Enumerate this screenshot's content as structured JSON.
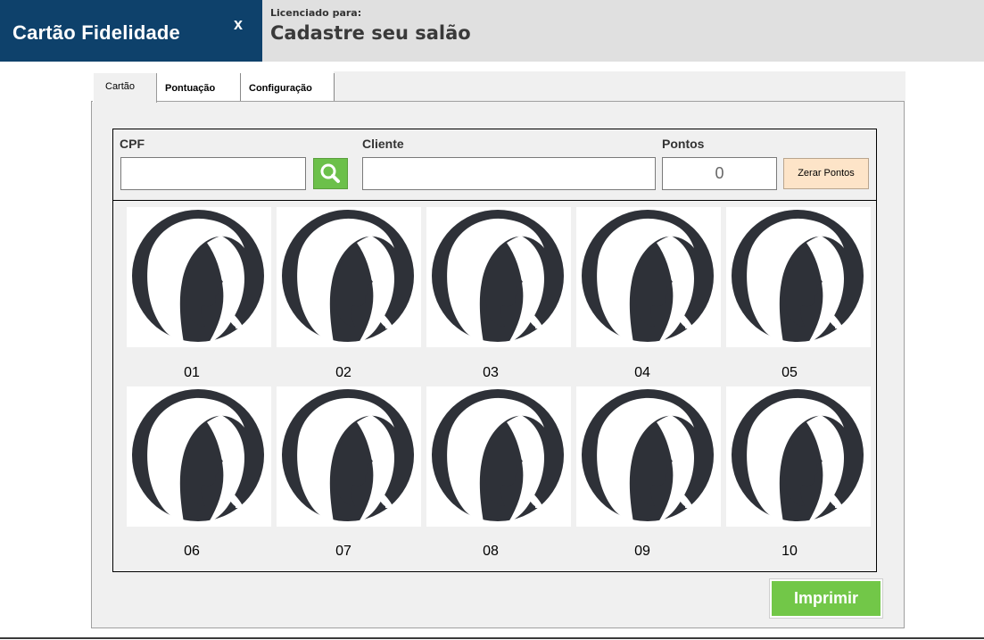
{
  "header": {
    "app_title": "Cartão Fidelidade",
    "close_label": "x",
    "license_label": "Licenciado para:",
    "license_name": "Cadastre seu salão",
    "title_bg": "#0e416b"
  },
  "tabs": [
    {
      "label": "Cartão",
      "active": true
    },
    {
      "label": "Pontuação",
      "active": false
    },
    {
      "label": "Configuração",
      "active": false
    }
  ],
  "form": {
    "cpf_label": "CPF",
    "cpf_value": "",
    "cliente_label": "Cliente",
    "cliente_value": "",
    "pontos_label": "Pontos",
    "pontos_value": "0",
    "search_icon": "magnifier-icon",
    "zerar_label": "Zerar Pontos"
  },
  "cards": [
    {
      "number": "01"
    },
    {
      "number": "02"
    },
    {
      "number": "03"
    },
    {
      "number": "04"
    },
    {
      "number": "05"
    },
    {
      "number": "06"
    },
    {
      "number": "07"
    },
    {
      "number": "08"
    },
    {
      "number": "09"
    },
    {
      "number": "10"
    }
  ],
  "card_icon": "woman-silhouette-icon",
  "print_label": "Imprimir",
  "colors": {
    "accent_green": "#72c748",
    "card_dark": "#2e3138",
    "zerar_bg": "#fde4c8"
  }
}
